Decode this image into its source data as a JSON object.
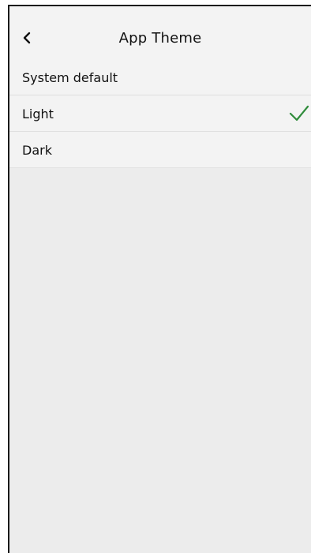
{
  "header": {
    "title": "App Theme",
    "back_icon": "chevron-left-icon"
  },
  "options": [
    {
      "label": "System default",
      "selected": false
    },
    {
      "label": "Light",
      "selected": true
    },
    {
      "label": "Dark",
      "selected": false
    }
  ],
  "colors": {
    "check": "#2e8b3a",
    "background": "#ececec",
    "row": "#f3f3f3"
  }
}
